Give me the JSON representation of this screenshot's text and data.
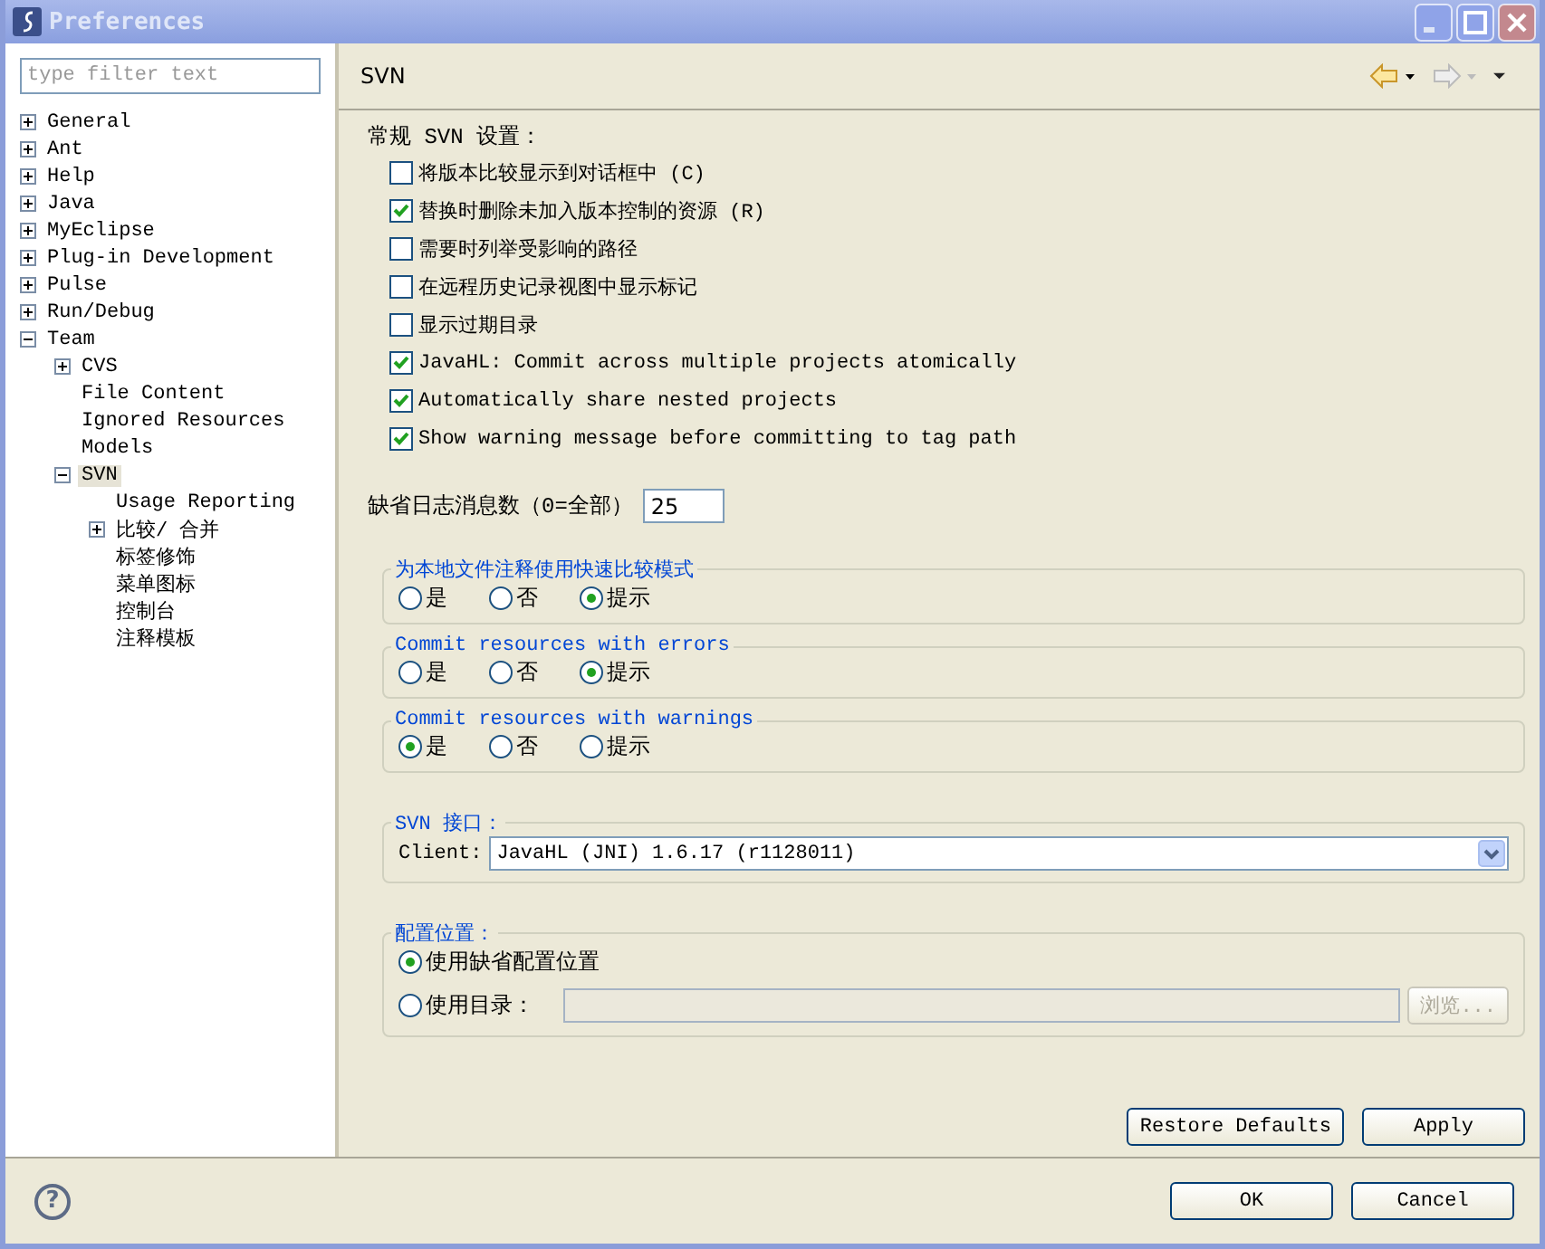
{
  "window": {
    "title": "Preferences",
    "active": false
  },
  "filter": {
    "placeholder": "type filter text"
  },
  "tree": [
    {
      "label": "General",
      "expanded": false,
      "selected": false
    },
    {
      "label": "Ant",
      "expanded": false,
      "selected": false
    },
    {
      "label": "Help",
      "expanded": false,
      "selected": false
    },
    {
      "label": "Java",
      "expanded": false,
      "selected": false
    },
    {
      "label": "MyEclipse",
      "expanded": false,
      "selected": false
    },
    {
      "label": "Plug-in Development",
      "expanded": false,
      "selected": false
    },
    {
      "label": "Pulse",
      "expanded": false,
      "selected": false
    },
    {
      "label": "Run/Debug",
      "expanded": false,
      "selected": false
    },
    {
      "label": "Team",
      "expanded": true,
      "selected": false,
      "children": [
        {
          "label": "CVS",
          "expanded": false,
          "selected": false
        },
        {
          "label": "File Content",
          "selected": false
        },
        {
          "label": "Ignored Resources",
          "selected": false
        },
        {
          "label": "Models",
          "selected": false
        },
        {
          "label": "SVN",
          "expanded": true,
          "selected": true,
          "children": [
            {
              "label": "Usage Reporting",
              "selected": false
            },
            {
              "label": "比较/ 合并",
              "expanded": false,
              "selected": false
            },
            {
              "label": "标签修饰",
              "selected": false
            },
            {
              "label": "菜单图标",
              "selected": false
            },
            {
              "label": "控制台",
              "selected": false
            },
            {
              "label": "注释模板",
              "selected": false
            }
          ]
        }
      ]
    }
  ],
  "page": {
    "title": "SVN"
  },
  "general_label": "常规 SVN 设置：",
  "options": [
    {
      "label": "将版本比较显示到对话框中 (C)",
      "checked": false
    },
    {
      "label": "替换时删除未加入版本控制的资源 (R)",
      "checked": true
    },
    {
      "label": "需要时列举受影响的路径",
      "checked": false
    },
    {
      "label": "在远程历史记录视图中显示标记",
      "checked": false
    },
    {
      "label": "显示过期目录",
      "checked": false
    },
    {
      "label": "JavaHL: Commit across multiple projects atomically",
      "checked": true
    },
    {
      "label": "Automatically share nested projects",
      "checked": true
    },
    {
      "label": "Show warning message before committing to tag path",
      "checked": true
    }
  ],
  "log_count": {
    "label": "缺省日志消息数（0=全部）",
    "value": "25"
  },
  "radio_groups": [
    {
      "title": "为本地文件注释使用快速比较模式",
      "options": [
        {
          "label": "是",
          "selected": false
        },
        {
          "label": "否",
          "selected": false
        },
        {
          "label": "提示",
          "selected": true
        }
      ]
    },
    {
      "title": "Commit resources with errors",
      "options": [
        {
          "label": "是",
          "selected": false
        },
        {
          "label": "否",
          "selected": false
        },
        {
          "label": "提示",
          "selected": true
        }
      ]
    },
    {
      "title": "Commit resources with warnings",
      "options": [
        {
          "label": "是",
          "selected": true
        },
        {
          "label": "否",
          "selected": false
        },
        {
          "label": "提示",
          "selected": false
        }
      ]
    }
  ],
  "interface": {
    "title": "SVN 接口：",
    "client_label": "Client:",
    "client_value": "JavaHL (JNI) 1.6.17 (r1128011)"
  },
  "config": {
    "title": "配置位置：",
    "options": [
      {
        "label": "使用缺省配置位置",
        "selected": true
      },
      {
        "label": "使用目录：",
        "selected": false
      }
    ],
    "browse": {
      "label": "浏览...",
      "disabled": true
    }
  },
  "page_buttons": [
    "Restore Defaults",
    "Apply"
  ],
  "help": {
    "label": "?"
  },
  "dialog_buttons": [
    "OK",
    "Cancel"
  ]
}
